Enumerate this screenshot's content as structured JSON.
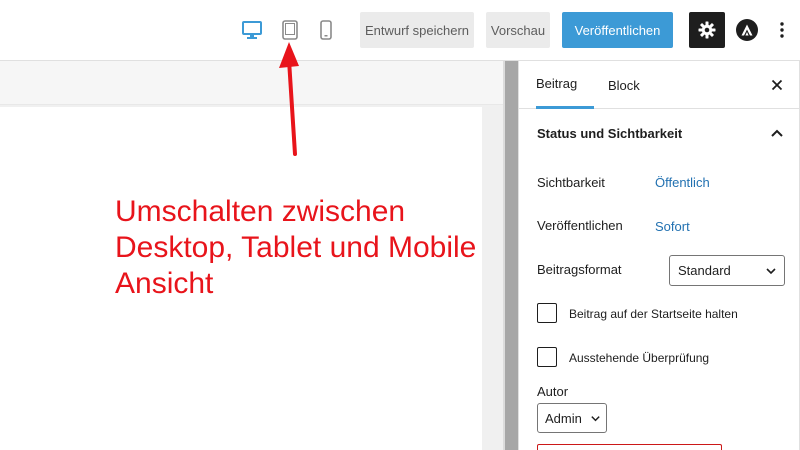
{
  "toolbar": {
    "device_buttons": [
      {
        "name": "desktop",
        "icon": "desktop-icon",
        "active": true
      },
      {
        "name": "tablet",
        "icon": "tablet-icon",
        "active": false
      },
      {
        "name": "mobile",
        "icon": "mobile-icon",
        "active": false
      }
    ],
    "save_draft_label": "Entwurf speichern",
    "preview_label": "Vorschau",
    "publish_label": "Veröffentlichen",
    "settings_icon": "gear-icon",
    "astra_icon": "astra-logo-icon",
    "more_icon": "vertical-ellipsis-icon"
  },
  "annotation": {
    "lines": [
      "Umschalten zwischen",
      "Desktop, Tablet und Mobile",
      "Ansicht"
    ],
    "color": "#e8141b"
  },
  "sidebar": {
    "tabs": [
      {
        "label": "Beitrag",
        "active": true
      },
      {
        "label": "Block",
        "active": false
      }
    ],
    "close_icon": "close-icon",
    "panel": {
      "title": "Status und Sichtbarkeit",
      "expanded": true,
      "visibility_label": "Sichtbarkeit",
      "visibility_value": "Öffentlich",
      "publish_label": "Veröffentlichen",
      "publish_value": "Sofort",
      "format_label": "Beitragsformat",
      "format_value": "Standard",
      "sticky_label": "Beitrag auf der Startseite halten",
      "pending_label": "Ausstehende Überprüfung",
      "author_label": "Autor",
      "author_value": "Admin"
    }
  },
  "colors": {
    "accent": "#3c9ad6",
    "link": "#2271b1",
    "dark": "#1e1e1e"
  }
}
